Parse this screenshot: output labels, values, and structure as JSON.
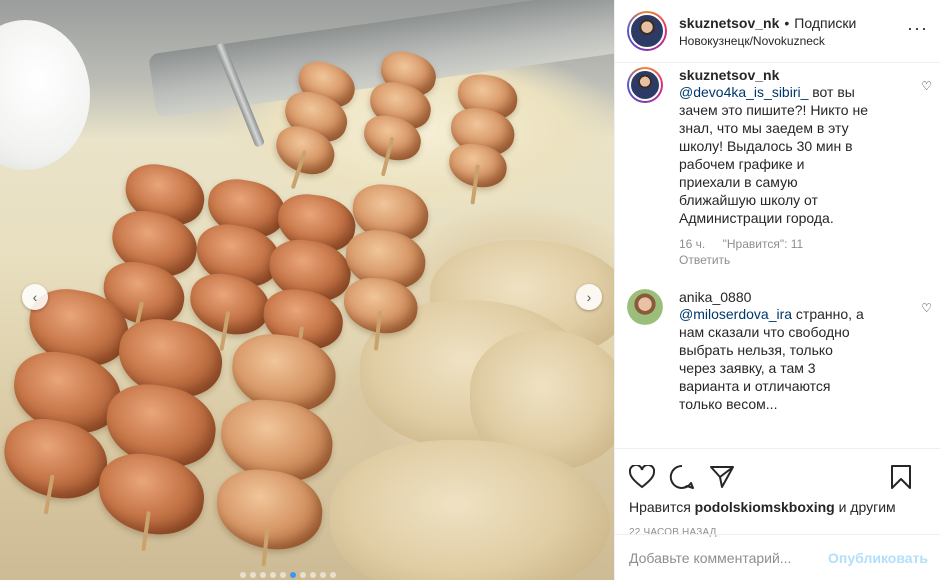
{
  "post": {
    "author": "skuznetsov_nk",
    "separator": "•",
    "follow_label": "Подписки",
    "location": "Новокузнецк/Novokuznec​k"
  },
  "comments": [
    {
      "username": "skuznetsov_nk",
      "mention": "@devo4ka_is_sibiri_",
      "text": " вот вы зачем это пишите?! Никто не знал, что мы заедем в эту школу! Выдалось 30 мин в рабочем графике и приехали в самую ближайшую школу от Администрации города.",
      "time": "16 ч.",
      "likes": "\"Нравится\": 11",
      "reply": "Ответить"
    },
    {
      "username": "anika_0880",
      "mention": "@miloserdova_ira",
      "text": " странно, а нам сказали что свободно выбрать нельзя, только через заявку, а там 3 варианта и отличаются только весом..."
    }
  ],
  "actions": {
    "likes_prefix": "Нравится",
    "likes_user": "podolskiomskboxing",
    "likes_suffix": "и другим",
    "timestamp": "22 ЧАСОВ НАЗАД"
  },
  "composer": {
    "placeholder": "Добавьте комментарий...",
    "publish_label": "Опубликовать"
  },
  "icons": {
    "header_more": "more-icon",
    "like": "heart-icon",
    "comment": "comment-icon",
    "share": "share-icon",
    "save": "bookmark-icon",
    "prev": "chevron-left-icon",
    "next": "chevron-right-icon"
  },
  "colors": {
    "link": "#00376b",
    "publish_disabled": "#b2dffc",
    "muted": "#8e8e8e",
    "carousel_active": "#3897f0"
  }
}
